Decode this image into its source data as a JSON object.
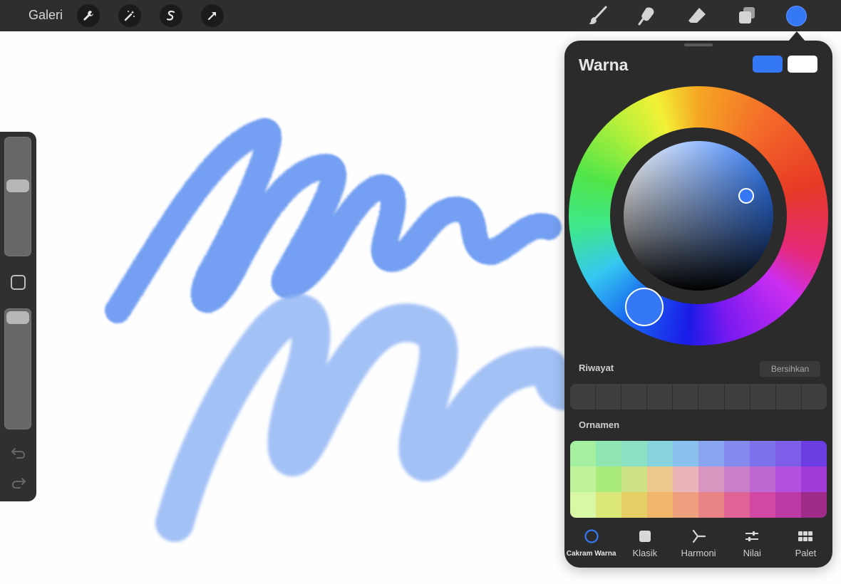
{
  "topbar": {
    "gallery_label": "Galeri",
    "left_tools": [
      "wrench-icon",
      "magic-wand-icon",
      "selection-s-icon",
      "arrow-transform-icon"
    ],
    "right_tools": [
      "brush-icon",
      "smudge-icon",
      "eraser-icon",
      "layers-icon"
    ],
    "active_color": "#3478f6"
  },
  "panel": {
    "title": "Warna",
    "primary_color": "#3478f6",
    "secondary_color": "#ffffff",
    "history_label": "Riwayat",
    "clear_label": "Bersihkan",
    "palette_label": "Ornamen",
    "palette_colors": [
      [
        "#a5f0a0",
        "#8fe6b0",
        "#8ce0c4",
        "#86d3dc",
        "#8ac0ee",
        "#8aa6f0",
        "#8489ee",
        "#7d72ec",
        "#7c5ee8",
        "#6a3ee3"
      ],
      [
        "#bff29b",
        "#a9ec7c",
        "#cde185",
        "#ecc78e",
        "#eab4b8",
        "#d896c0",
        "#c97ec8",
        "#bd67d0",
        "#b350df",
        "#a23ad8"
      ],
      [
        "#d8f8a6",
        "#dbe879",
        "#e6d065",
        "#f0b76a",
        "#eea07e",
        "#e88486",
        "#df6495",
        "#d048a4",
        "#bb3aa3",
        "#9e2b8a"
      ]
    ],
    "tabs": [
      {
        "label": "Cakram Warna",
        "icon": "circle-icon"
      },
      {
        "label": "Klasik",
        "icon": "square-icon"
      },
      {
        "label": "Harmoni",
        "icon": "harmony-icon"
      },
      {
        "label": "Nilai",
        "icon": "sliders-icon"
      },
      {
        "label": "Palet",
        "icon": "grid-icon"
      }
    ]
  }
}
